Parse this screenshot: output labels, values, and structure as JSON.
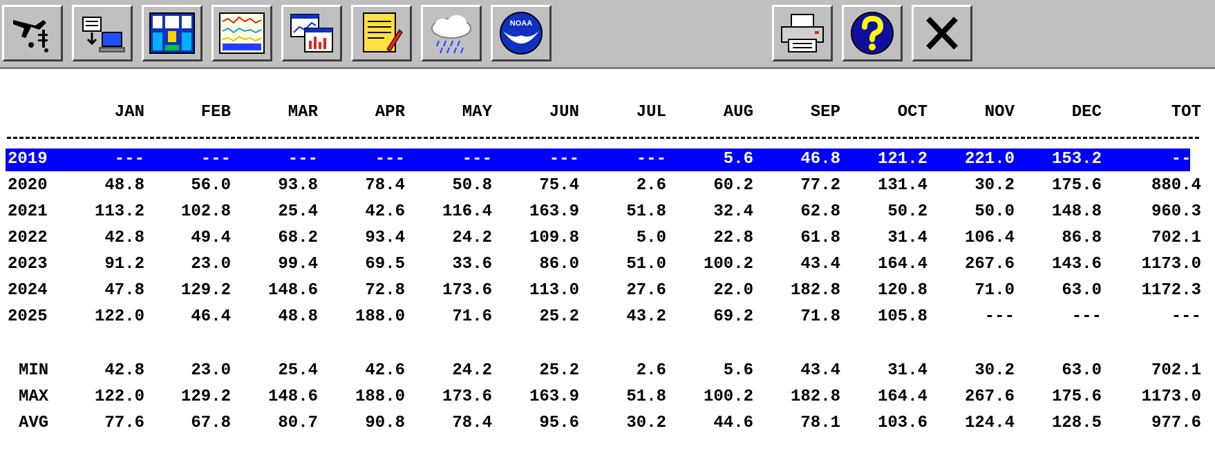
{
  "toolbar": {
    "buttons": [
      {
        "icon": "aircraft-data-icon"
      },
      {
        "icon": "data-download-icon"
      },
      {
        "icon": "station-panel-icon"
      },
      {
        "icon": "line-graph-icon"
      },
      {
        "icon": "charts-window-icon"
      },
      {
        "icon": "notepad-icon"
      },
      {
        "icon": "rain-cloud-icon"
      },
      {
        "icon": "noaa-logo-icon",
        "logo_text": "NOAA"
      },
      {
        "icon": "printer-icon"
      },
      {
        "icon": "help-icon"
      },
      {
        "icon": "close-icon"
      }
    ]
  },
  "colors": {
    "toolbar_bg": "#c0c0c0",
    "selection": "#0000ff",
    "selection_text": "#ffffff"
  },
  "table": {
    "headers": [
      "JAN",
      "FEB",
      "MAR",
      "APR",
      "MAY",
      "JUN",
      "JUL",
      "AUG",
      "SEP",
      "OCT",
      "NOV",
      "DEC",
      "TOT"
    ],
    "years": [
      {
        "year": "2019",
        "selected": true,
        "values": [
          "---",
          "---",
          "---",
          "---",
          "---",
          "---",
          "---",
          "5.6",
          "46.8",
          "121.2",
          "221.0",
          "153.2",
          "---"
        ]
      },
      {
        "year": "2020",
        "values": [
          "48.8",
          "56.0",
          "93.8",
          "78.4",
          "50.8",
          "75.4",
          "2.6",
          "60.2",
          "77.2",
          "131.4",
          "30.2",
          "175.6",
          "880.4"
        ]
      },
      {
        "year": "2021",
        "values": [
          "113.2",
          "102.8",
          "25.4",
          "42.6",
          "116.4",
          "163.9",
          "51.8",
          "32.4",
          "62.8",
          "50.2",
          "50.0",
          "148.8",
          "960.3"
        ]
      },
      {
        "year": "2022",
        "values": [
          "42.8",
          "49.4",
          "68.2",
          "93.4",
          "24.2",
          "109.8",
          "5.0",
          "22.8",
          "61.8",
          "31.4",
          "106.4",
          "86.8",
          "702.1"
        ]
      },
      {
        "year": "2023",
        "values": [
          "91.2",
          "23.0",
          "99.4",
          "69.5",
          "33.6",
          "86.0",
          "51.0",
          "100.2",
          "43.4",
          "164.4",
          "267.6",
          "143.6",
          "1173.0"
        ]
      },
      {
        "year": "2024",
        "values": [
          "47.8",
          "129.2",
          "148.6",
          "72.8",
          "173.6",
          "113.0",
          "27.6",
          "22.0",
          "182.8",
          "120.8",
          "71.0",
          "63.0",
          "1172.3"
        ]
      },
      {
        "year": "2025",
        "values": [
          "122.0",
          "46.4",
          "48.8",
          "188.0",
          "71.6",
          "25.2",
          "43.2",
          "69.2",
          "71.8",
          "105.8",
          "---",
          "---",
          "---"
        ]
      }
    ],
    "stats": [
      {
        "label": "MIN",
        "values": [
          "42.8",
          "23.0",
          "25.4",
          "42.6",
          "24.2",
          "25.2",
          "2.6",
          "5.6",
          "43.4",
          "31.4",
          "30.2",
          "63.0",
          "702.1"
        ]
      },
      {
        "label": "MAX",
        "values": [
          "122.0",
          "129.2",
          "148.6",
          "188.0",
          "173.6",
          "163.9",
          "51.8",
          "100.2",
          "182.8",
          "164.4",
          "267.6",
          "175.6",
          "1173.0"
        ]
      },
      {
        "label": "AVG",
        "values": [
          "77.6",
          "67.8",
          "80.7",
          "90.8",
          "78.4",
          "95.6",
          "30.2",
          "44.6",
          "78.1",
          "103.6",
          "124.4",
          "128.5",
          "977.6"
        ]
      }
    ]
  }
}
